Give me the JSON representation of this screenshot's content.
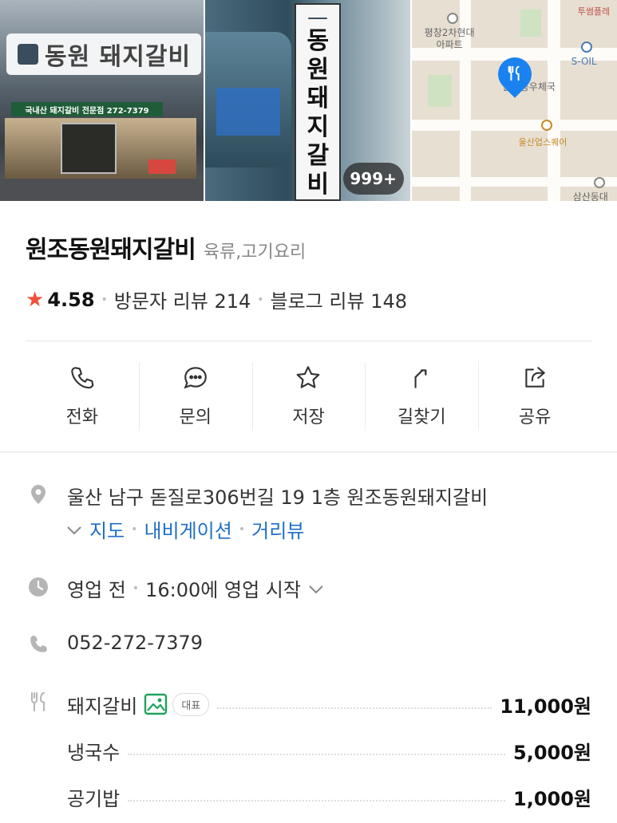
{
  "photos": {
    "sign_text": "동원 돼지갈비",
    "band_text": "국내산 돼지갈비 전문점 272-7379",
    "vertical_sign_chars": [
      "동",
      "원",
      "돼",
      "지",
      "갈",
      "비"
    ],
    "photo_count_badge": "999+"
  },
  "map": {
    "labels": {
      "apartment": "평창2차현대\n아파트",
      "gas_station": "S-OIL",
      "post_office": "울산동우체국",
      "square": "울산업스퀘어",
      "top_right": "투썸플레",
      "bottom_right": "삼산동대"
    },
    "pin_icon": "fork-knife-icon"
  },
  "place": {
    "name": "원조동원돼지갈비",
    "category": "육류,고기요리",
    "rating": "4.58",
    "visitor_reviews": "방문자 리뷰 214",
    "blog_reviews": "블로그 리뷰 148"
  },
  "actions": [
    {
      "label": "전화",
      "icon": "phone-icon"
    },
    {
      "label": "문의",
      "icon": "chat-icon"
    },
    {
      "label": "저장",
      "icon": "star-icon"
    },
    {
      "label": "길찾기",
      "icon": "directions-icon"
    },
    {
      "label": "공유",
      "icon": "share-icon"
    }
  ],
  "info": {
    "address": "울산 남구 돋질로306번길 19 1층 원조동원돼지갈비",
    "address_links": [
      "지도",
      "내비게이션",
      "거리뷰"
    ],
    "hours_status": "영업 전",
    "hours_detail": "16:00에 영업 시작",
    "phone": "052-272-7379"
  },
  "menu": [
    {
      "name": "돼지갈비",
      "price": "11,000원",
      "badge": "대표",
      "has_photo": true
    },
    {
      "name": "냉국수",
      "price": "5,000원"
    },
    {
      "name": "공기밥",
      "price": "1,000원"
    }
  ],
  "colors": {
    "star": "#f04f3d",
    "link": "#1f6fc5",
    "pin": "#1a82f0",
    "photo_icon": "#1fa35c"
  }
}
